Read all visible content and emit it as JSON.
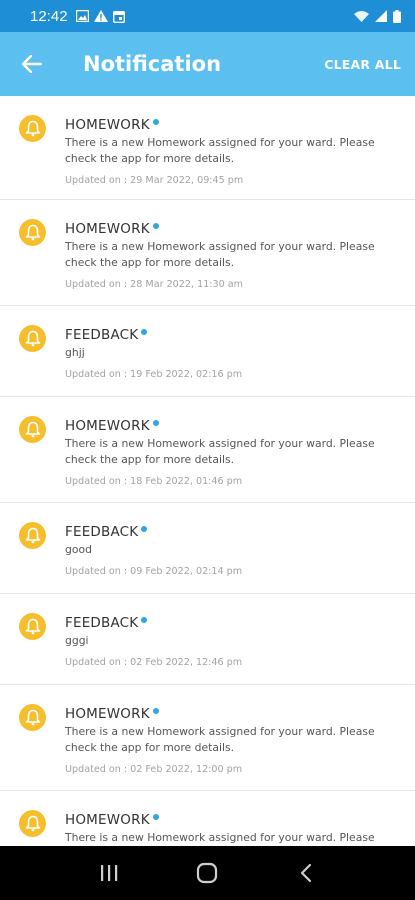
{
  "status_bar": {
    "time": "12:42"
  },
  "app_bar": {
    "title": "Notification",
    "clear_all_label": "CLEAR ALL"
  },
  "colors": {
    "status_bar": "#1e8fd6",
    "app_bar": "#5bc0f0",
    "bell": "#f6be2c",
    "unread_dot": "#2fa6e0"
  },
  "notifications": [
    {
      "title": "HOMEWORK",
      "message": "There is a new Homework assigned for your ward. Please check the app for more details.",
      "date": "Updated on : 29 Mar 2022, 09:45 pm"
    },
    {
      "title": "HOMEWORK",
      "message": "There is a new Homework assigned for your ward. Please check the app for more details.",
      "date": "Updated on : 28 Mar 2022, 11:30 am"
    },
    {
      "title": "FEEDBACK",
      "message": "ghjj",
      "date": "Updated on : 19 Feb 2022, 02:16 pm"
    },
    {
      "title": "HOMEWORK",
      "message": "There is a new Homework assigned for your ward. Please check the app for more details.",
      "date": "Updated on : 18 Feb 2022, 01:46 pm"
    },
    {
      "title": "FEEDBACK",
      "message": "good",
      "date": "Updated on : 09 Feb 2022, 02:14 pm"
    },
    {
      "title": "FEEDBACK",
      "message": "gggi",
      "date": "Updated on : 02 Feb 2022, 12:46 pm"
    },
    {
      "title": "HOMEWORK",
      "message": "There is a new Homework assigned for your ward. Please check the app for more details.",
      "date": "Updated on : 02 Feb 2022, 12:00 pm"
    },
    {
      "title": "HOMEWORK",
      "message": "There is a new Homework assigned for your ward. Please",
      "date": ""
    }
  ]
}
